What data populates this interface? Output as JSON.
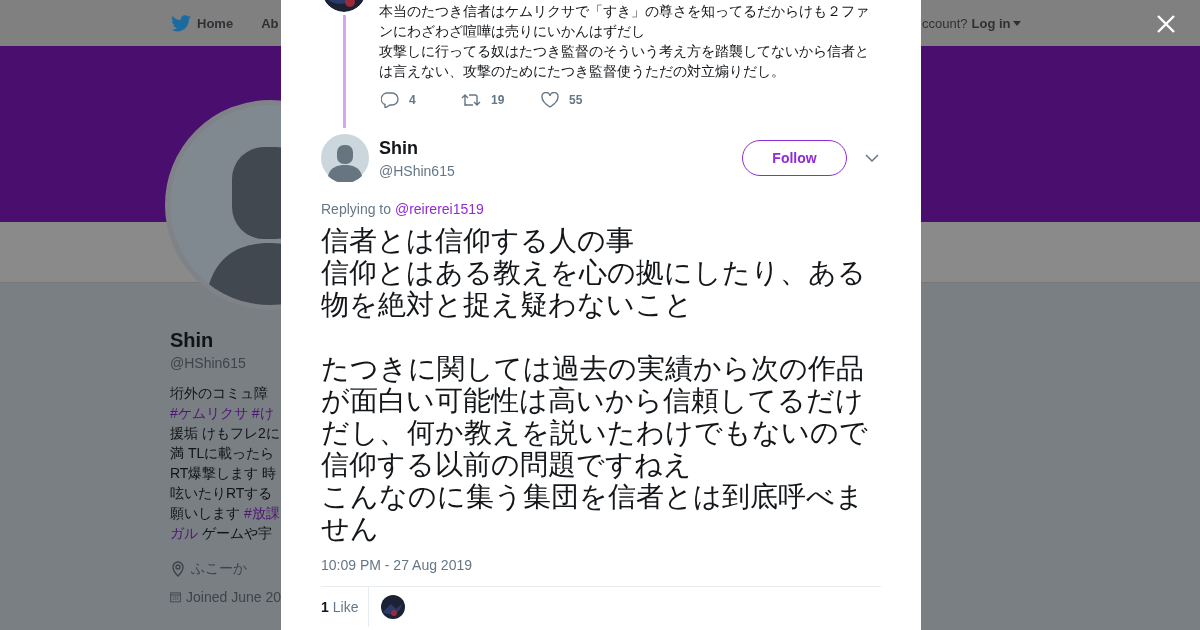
{
  "nav": {
    "home": "Home",
    "about": "Ab",
    "account_prompt": "ccount?",
    "login": "Log in"
  },
  "profile": {
    "name": "Shin",
    "handle": "@HShin615",
    "bio_lines": [
      [
        {
          "kind": "text",
          "text": "垳外のコミュ障"
        }
      ],
      [
        {
          "kind": "hashtag",
          "text": "#ケムリクサ"
        },
        {
          "kind": "hashtag",
          "text": "#け"
        }
      ],
      [
        {
          "kind": "text",
          "text": "援垢 けもフレ2に"
        }
      ],
      [
        {
          "kind": "text",
          "text": "満 TLに載ったら"
        }
      ],
      [
        {
          "kind": "text",
          "text": "RT爆撃します 時"
        }
      ],
      [
        {
          "kind": "text",
          "text": "呟いたりRTする"
        }
      ],
      [
        {
          "kind": "text",
          "text": "願いします"
        },
        {
          "kind": "hashtag",
          "text": "#放課"
        }
      ],
      [
        {
          "kind": "hashtag",
          "text": "ガル"
        },
        {
          "kind": "text",
          "text": "ゲームや宇"
        }
      ]
    ],
    "location": "ふこーか",
    "joined": "Joined June 20"
  },
  "previous_tweet": {
    "lines": [
      "本当のたつき信者はケムリクサで「すき」の尊さを知ってるだからけも２ファンにわざわざ喧嘩は売りにいかんはずだし",
      "攻撃しに行ってる奴はたつき監督のそういう考え方を踏襲してないから信者とは言えない、攻撃のためにたつき監督使うただの対立煽りだし。"
    ],
    "replies": "4",
    "retweets": "19",
    "likes": "55"
  },
  "tweet": {
    "name": "Shin",
    "handle": "@HShin615",
    "follow_label": "Follow",
    "replying_label": "Replying to",
    "replying_to": "@reirerei1519",
    "paragraphs": [
      [
        "信者とは信仰する人の事",
        "信仰とはある教えを心の拠にしたり、ある物を絶対と捉え疑わないこと"
      ],
      [
        "たつきに関しては過去の実績から次の作品が面白い可能性は高いから信頼してるだけだし、何か教えを説いたわけでもないので信仰する以前の問題ですねえ",
        "こんなのに集う集団を信者とは到底呼べません"
      ]
    ],
    "timestamp": "10:09 PM - 27 Aug 2019",
    "like_count": "1",
    "like_label": "Like"
  }
}
